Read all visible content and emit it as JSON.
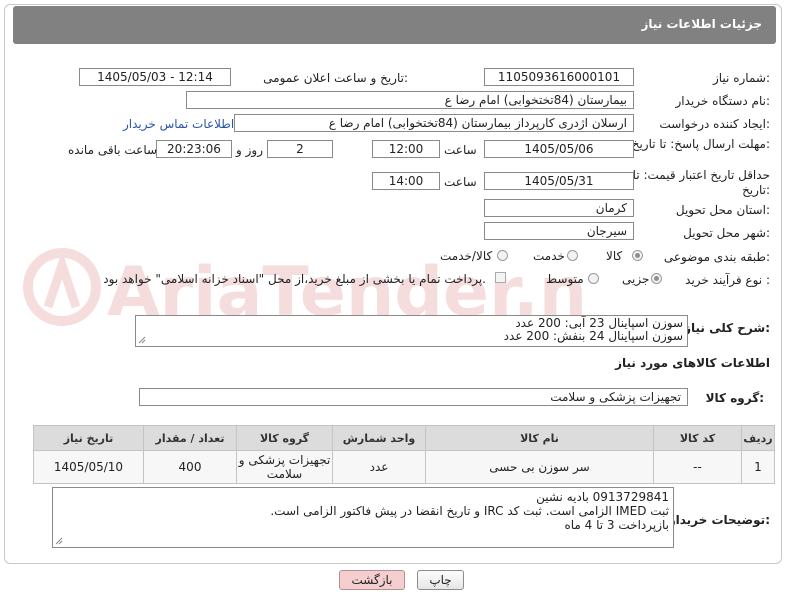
{
  "header": {
    "title": "جزئیات اطلاعات نیاز"
  },
  "fields": {
    "need_number": {
      "label": "شماره نیاز:",
      "value": "1105093616000101"
    },
    "announce_datetime": {
      "label": "تاریخ و ساعت اعلان عمومی:",
      "value": "1405/05/03 - 12:14"
    },
    "buyer_org": {
      "label": "نام دستگاه خریدار:",
      "value": "بیمارستان (84تختخوابی) امام رضا  ع"
    },
    "creator": {
      "label": "ایجاد کننده درخواست:",
      "value": "ارسلان اژدری کارپرداز بیمارستان (84تختخوابی) امام رضا  ع",
      "contact_link": "اطلاعات تماس خریدار"
    },
    "reply_deadline": {
      "label": "مهلت ارسال پاسخ: تا تاریخ:",
      "date": "1405/05/06",
      "time_label": "ساعت",
      "time": "12:00",
      "days": "2",
      "days_label": "روز و",
      "remaining": "20:23:06",
      "remaining_label": "ساعت باقی مانده"
    },
    "price_validity": {
      "label": "حداقل تاریخ اعتبار قیمت: تا تاریخ:",
      "date": "1405/05/31",
      "time_label": "ساعت",
      "time": "14:00"
    },
    "delivery_province": {
      "label": "استان محل تحویل:",
      "value": "کرمان"
    },
    "delivery_city": {
      "label": "شهر محل تحویل:",
      "value": "سیرجان"
    },
    "category": {
      "label": "طبقه بندی موضوعی:",
      "options": [
        "کالا",
        "خدمت",
        "کالا/خدمت"
      ]
    },
    "process_type": {
      "label": "نوع فرآیند خرید :",
      "options": [
        "جزیی",
        "متوسط"
      ],
      "payment_note": "پرداخت تمام یا بخشی از مبلغ خرید،از محل \"اسناد خزانه اسلامی\" خواهد بود."
    }
  },
  "description": {
    "label": "شرح کلی نیاز:",
    "lines": [
      "سوزن اسپاینال 23 آبی: 200 عدد",
      "سوزن اسپاینال 24 بنفش: 200 عدد"
    ]
  },
  "goods_info": {
    "title": "اطلاعات کالاهای مورد نیاز",
    "group_label": "گروه کالا:",
    "group_value": "تجهیزات پزشکی و سلامت"
  },
  "table": {
    "headers": [
      "ردیف",
      "کد کالا",
      "نام کالا",
      "واحد شمارش",
      "گروه کالا",
      "تعداد / مقدار",
      "تاریخ نیاز"
    ],
    "rows": [
      {
        "row": "1",
        "code": "--",
        "name": "سر سوزن بی حسی",
        "unit": "عدد",
        "group": "تجهیزات پزشکی و سلامت",
        "qty": "400",
        "date": "1405/05/10"
      }
    ]
  },
  "buyer_notes": {
    "label": "توضیحات خریدار:",
    "lines": [
      "0913729841 بادیه نشین",
      "ثبت IMED الزامی است. ثبت کد IRC و تاریخ انقضا در پیش فاکتور الزامی است.",
      "بازپرداخت 3 تا 4 ماه"
    ]
  },
  "buttons": {
    "print": "چاپ",
    "back": "بازگشت"
  },
  "watermark": {
    "text": "AriaTender.net"
  },
  "colors": {
    "header": "#818181",
    "link": "#2a55a5",
    "back_button": "#f5cfcf"
  }
}
